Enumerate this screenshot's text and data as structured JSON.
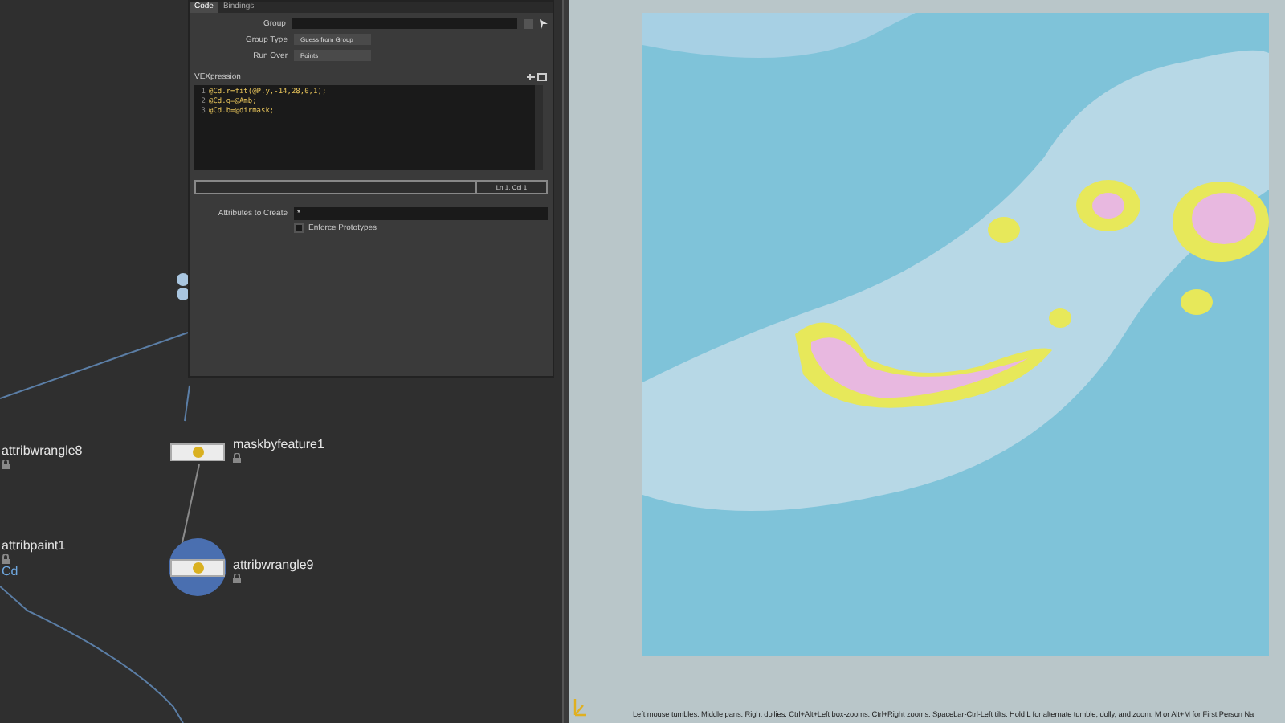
{
  "parameter_panel": {
    "tabs": [
      {
        "label": "Code",
        "selected": true
      },
      {
        "label": "Bindings",
        "selected": false
      }
    ],
    "fields": [
      {
        "kind": "text",
        "label": "Group"
      },
      {
        "kind": "menu",
        "label": "Group Type",
        "value": "Guess from Group"
      },
      {
        "kind": "menu",
        "label": "Run Over",
        "value": "Points"
      }
    ],
    "vexpression": {
      "label": "VEXpression",
      "lines": [
        {
          "number": "1",
          "text": "@Cd.r=fit(@P.y,-14,28,0,1);"
        },
        {
          "number": "2",
          "text": "@Cd.g=@Amb;"
        },
        {
          "number": "3",
          "text": "@Cd.b=@dirmask;"
        }
      ],
      "cursor_position": "Ln 1, Col 1"
    },
    "attributes_to_create": {
      "label": "Attributes to Create",
      "value": "*"
    },
    "enforce_prototypes": {
      "label": "Enforce Prototypes",
      "checked": false
    }
  },
  "network": {
    "nodes": [
      {
        "name": "attribwrangle8",
        "kind": "label"
      },
      {
        "name": "maskbyfeature1",
        "kind": "node",
        "selected": false
      },
      {
        "name": "attribpaint1",
        "kind": "label",
        "attribute": "Cd"
      },
      {
        "name": "attribwrangle9",
        "kind": "node",
        "selected": true
      }
    ]
  },
  "viewport": {
    "status_text": "Left mouse tumbles. Middle pans. Right dollies. Ctrl+Alt+Left box-zooms. Ctrl+Right zooms. Spacebar-Ctrl-Left tilts. Hold L for alternate tumble, dolly, and zoom.    M or Alt+M for First Person Na"
  }
}
